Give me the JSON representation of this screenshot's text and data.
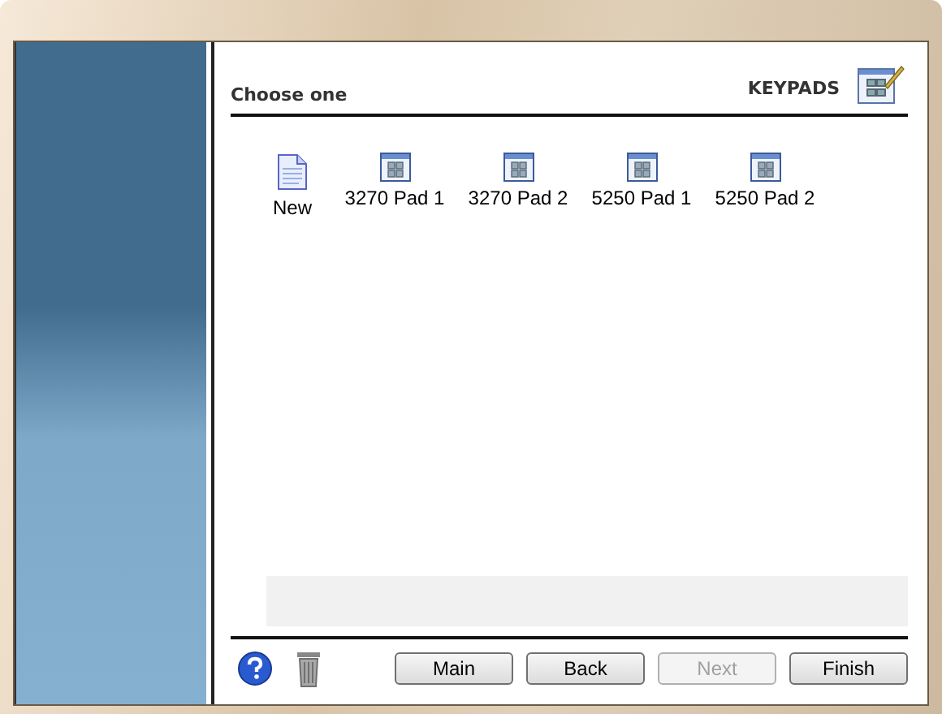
{
  "header": {
    "title": "Choose one",
    "section": "KEYPADS"
  },
  "items": [
    {
      "label": "New",
      "kind": "new"
    },
    {
      "label": "3270 Pad 1",
      "kind": "keypad"
    },
    {
      "label": "3270 Pad 2",
      "kind": "keypad"
    },
    {
      "label": "5250 Pad 1",
      "kind": "keypad"
    },
    {
      "label": "5250 Pad 2",
      "kind": "keypad"
    }
  ],
  "buttons": [
    {
      "label": "Main",
      "disabled": false
    },
    {
      "label": "Back",
      "disabled": false
    },
    {
      "label": "Next",
      "disabled": true
    },
    {
      "label": "Finish",
      "disabled": false
    }
  ]
}
